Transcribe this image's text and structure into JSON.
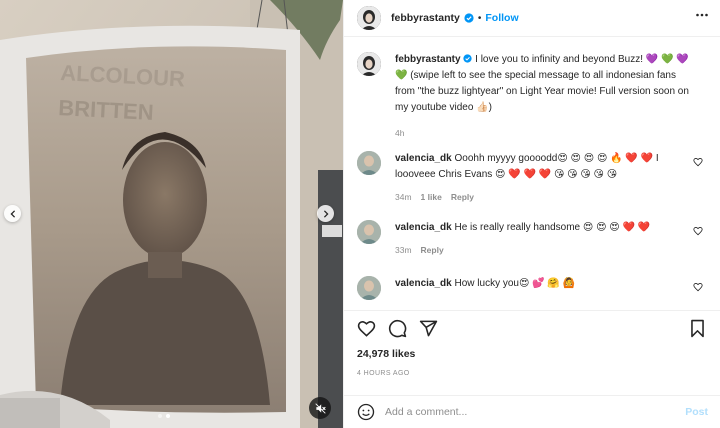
{
  "header": {
    "username": "febbyrastanty",
    "separator": "•",
    "follow_label": "Follow"
  },
  "caption": {
    "username": "febbyrastanty",
    "text": "I love you to infinity and beyond Buzz! 💜 💚 💜 💚 (swipe left to see the special message to all indonesian fans from \"the buzz lightyear\" on Light Year movie! Full version soon on my youtube video 👍🏻)",
    "time": "4h"
  },
  "comments": [
    {
      "username": "valencia_dk",
      "text": "Ooohh myyyy goooodd😍 😍 😍 😍 🔥 ❤️ ❤️ I loooveee Chris Evans 😍 ❤️ ❤️ ❤️ 😘 😘 😘 😘 😘",
      "time": "34m",
      "likes": "1 like",
      "reply": "Reply"
    },
    {
      "username": "valencia_dk",
      "text": "He is really really handsome 😍 😍 😍 ❤️ ❤️",
      "time": "33m",
      "reply": "Reply"
    },
    {
      "username": "valencia_dk",
      "text": "How lucky you😍 💕 🤗 🙆"
    }
  ],
  "likes_label": "24,978 likes",
  "timestamp": "4 HOURS AGO",
  "composer": {
    "placeholder": "Add a comment...",
    "post_label": "Post"
  },
  "carousel": {
    "current": 2,
    "total": 2
  },
  "colors": {
    "accent": "#0095f6",
    "post_disabled": "#b2dffc",
    "muted_text": "#8e8e8e",
    "heart": "#ed4956"
  },
  "icons": [
    "verified-badge-icon",
    "more-options-icon",
    "chevron-left-icon",
    "chevron-right-icon",
    "sound-off-icon",
    "heart-icon",
    "comment-icon",
    "share-icon",
    "save-icon",
    "emoji-icon"
  ]
}
